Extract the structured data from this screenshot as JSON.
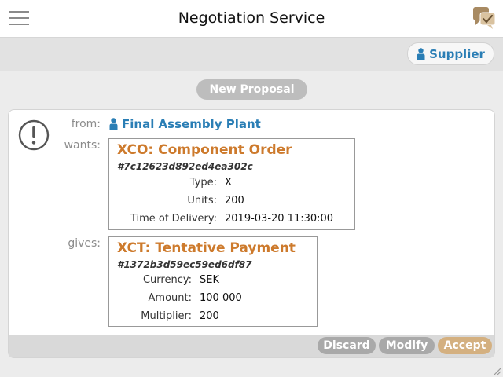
{
  "header": {
    "title": "Negotiation Service",
    "menu_icon": "hamburger-menu-icon",
    "chat_icon": "chat-tasks-icon"
  },
  "role": {
    "label": "Supplier",
    "icon": "person-icon"
  },
  "new_proposal": {
    "label": "New Proposal"
  },
  "proposal": {
    "alert_icon": "exclamation-circle-icon",
    "from_label": "from:",
    "from_value": "Final Assembly Plant",
    "wants_label": "wants:",
    "wants": {
      "title": "XCO: Component Order",
      "hash": "#7c12623d892ed4ea302c",
      "props": [
        {
          "key": "Type:",
          "value": "X"
        },
        {
          "key": "Units:",
          "value": "200"
        },
        {
          "key": "Time of Delivery:",
          "value": "2019-03-20 11:30:00"
        }
      ]
    },
    "gives_label": "gives:",
    "gives": {
      "title": "XCT: Tentative Payment",
      "hash": "#1372b3d59ec59ed6df87",
      "props": [
        {
          "key": "Currency:",
          "value": "SEK"
        },
        {
          "key": "Amount:",
          "value": "100 000"
        },
        {
          "key": "Multiplier:",
          "value": "200"
        }
      ]
    },
    "actions": {
      "discard": "Discard",
      "modify": "Modify",
      "accept": "Accept"
    }
  },
  "colors": {
    "accent_blue": "#2a7eb5",
    "accent_orange": "#cd7a2c",
    "accept": "#d4b080",
    "neutral_button": "#a9a9a9"
  }
}
